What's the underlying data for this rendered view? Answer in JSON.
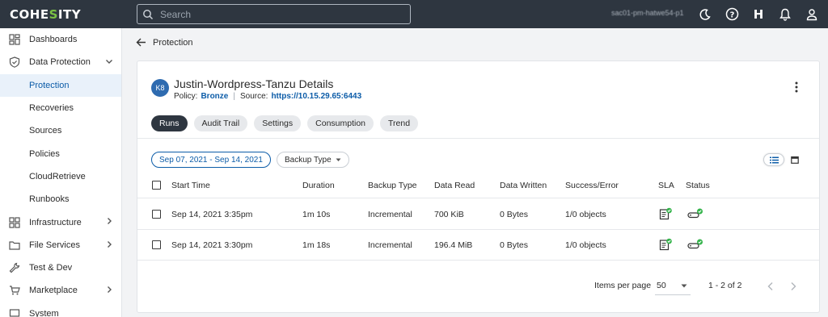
{
  "brand": {
    "logo_pre": "COHE",
    "logo_dot": "S",
    "logo_post": "ITY"
  },
  "header": {
    "search_placeholder": "Search",
    "cluster_name": "sac01-pm-hatwe54-p1",
    "help_letter": "H",
    "icons": [
      "moon-icon",
      "help-circle-icon",
      "bell-icon",
      "user-icon"
    ]
  },
  "sidebar": {
    "items": [
      {
        "label": "Dashboards",
        "icon": "dashboard-icon"
      },
      {
        "label": "Data Protection",
        "icon": "shield-icon",
        "expanded": true
      },
      {
        "label": "Protection",
        "active": true
      },
      {
        "label": "Recoveries"
      },
      {
        "label": "Sources"
      },
      {
        "label": "Policies"
      },
      {
        "label": "CloudRetrieve"
      },
      {
        "label": "Runbooks"
      },
      {
        "label": "Infrastructure",
        "icon": "infrastructure-icon"
      },
      {
        "label": "File Services",
        "icon": "folder-icon"
      },
      {
        "label": "Test & Dev",
        "icon": "wrench-icon"
      },
      {
        "label": "Marketplace",
        "icon": "cart-icon"
      },
      {
        "label": "System",
        "icon": "system-icon"
      }
    ]
  },
  "breadcrumb": {
    "label": "Protection"
  },
  "details": {
    "badge": "K8",
    "title": "Justin-Wordpress-Tanzu Details",
    "policy_label": "Policy:",
    "policy_value": "Bronze",
    "source_label": "Source:",
    "source_value": "https://10.15.29.65:6443"
  },
  "tabs": [
    {
      "label": "Runs",
      "active": true
    },
    {
      "label": "Audit Trail"
    },
    {
      "label": "Settings"
    },
    {
      "label": "Consumption"
    },
    {
      "label": "Trend"
    }
  ],
  "filters": {
    "date_range": "Sep 07, 2021 - Sep 14, 2021",
    "backup_type": "Backup Type"
  },
  "table": {
    "columns": [
      "Start Time",
      "Duration",
      "Backup Type",
      "Data Read",
      "Data Written",
      "Success/Error",
      "SLA",
      "Status"
    ],
    "rows": [
      {
        "start_time": "Sep 14, 2021 3:35pm",
        "duration": "1m 10s",
        "backup_type": "Incremental",
        "data_read": "700 KiB",
        "data_written": "0 Bytes",
        "success_error": "1/0 objects",
        "sla": "met",
        "status": "success"
      },
      {
        "start_time": "Sep 14, 2021 3:30pm",
        "duration": "1m 18s",
        "backup_type": "Incremental",
        "data_read": "196.4 MiB",
        "data_written": "0 Bytes",
        "success_error": "1/0 objects",
        "sla": "met",
        "status": "success"
      }
    ]
  },
  "pagination": {
    "items_per_page_label": "Items per page",
    "items_per_page": "50",
    "range": "1 - 2 of 2"
  },
  "colors": {
    "topbar": "#2e3640",
    "accent": "#0c5ca8",
    "success": "#33b34a"
  }
}
